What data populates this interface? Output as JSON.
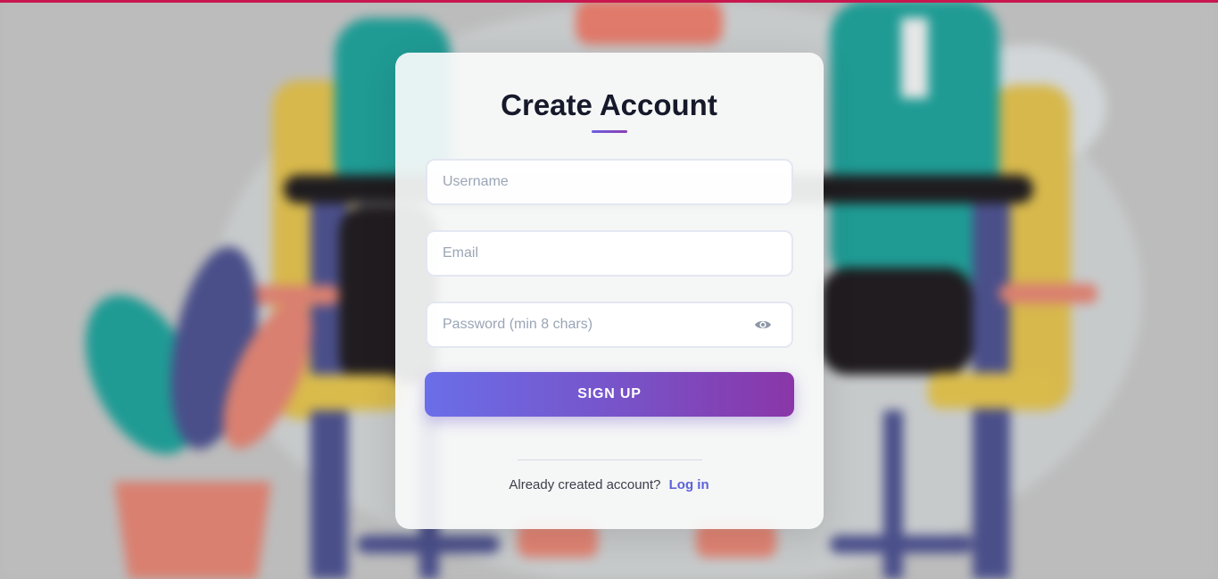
{
  "form": {
    "title": "Create Account",
    "username_placeholder": "Username",
    "email_placeholder": "Email",
    "password_placeholder": "Password (min 8 chars)",
    "password_toggle_icon": "eye-icon",
    "submit_label": "SIGN UP"
  },
  "footer": {
    "prompt_text": "Already created account?",
    "login_link_label": "Log in"
  },
  "colors": {
    "top_strip": "#c8174f",
    "accent_start": "#6a6ee8",
    "accent_end": "#8a36a8",
    "link": "#5d62d9"
  }
}
